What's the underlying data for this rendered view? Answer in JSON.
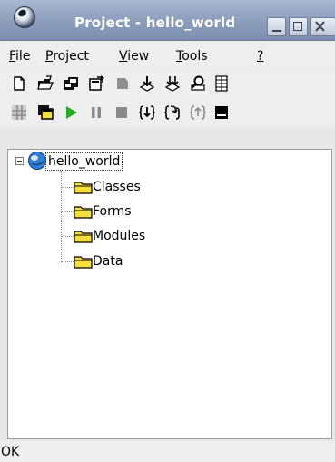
{
  "window": {
    "title": "Project - hello_world",
    "controls": {
      "minimize": "minimize",
      "maximize": "maximize",
      "close": "close"
    }
  },
  "menu": {
    "items": [
      {
        "label": "File",
        "mnemonic": "F"
      },
      {
        "label": "Project",
        "mnemonic": "P"
      },
      {
        "label": "View",
        "mnemonic": "V"
      },
      {
        "label": "Tools",
        "mnemonic": "T"
      },
      {
        "label": "?",
        "mnemonic": "?"
      }
    ]
  },
  "toolbar1": {
    "icons": [
      "new-file-icon",
      "open-folder-icon",
      "save-project-icon",
      "properties-icon",
      "disabled-icon",
      "download-icon",
      "download-all-icon",
      "find-icon",
      "table-icon"
    ]
  },
  "toolbar2": {
    "icons": [
      "grid-icon",
      "window-icon",
      "run-icon",
      "pause-icon",
      "stop-icon",
      "step-into-icon",
      "step-over-icon",
      "step-out-icon",
      "console-icon"
    ]
  },
  "tree": {
    "root": {
      "label": "hello_world",
      "expanded": true
    },
    "children": [
      {
        "label": "Classes"
      },
      {
        "label": "Forms"
      },
      {
        "label": "Modules"
      },
      {
        "label": "Data"
      }
    ]
  },
  "status": {
    "text": "OK"
  },
  "colors": {
    "titlebar": "#8e9fbd",
    "folder_fill": "#f6dd3e",
    "run_green": "#1fb01f"
  }
}
